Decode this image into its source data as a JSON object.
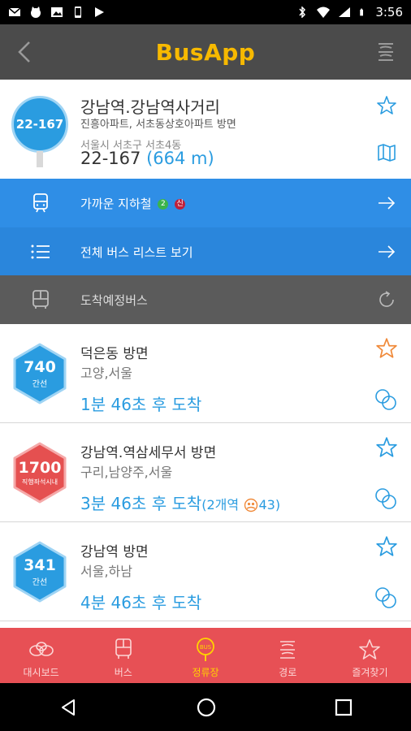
{
  "status_bar": {
    "time": "3:56",
    "icons": [
      "gmail-icon",
      "cat-icon",
      "image-icon",
      "phone-icon",
      "play-icon",
      "bluetooth-icon",
      "wifi-icon",
      "signal-icon",
      "battery-icon"
    ]
  },
  "app_bar": {
    "title": "BusApp",
    "back_icon": "chevron-left-icon",
    "menu_icon": "menu-icon",
    "title_color": "#f7b900"
  },
  "stop": {
    "sign_label": "22-167",
    "name": "강남역.강남역사거리",
    "direction": "진흥아파트, 서초동상호아파트 방면",
    "address": "서울시 서초구 서초4동",
    "id": "22-167",
    "distance": "(664 m)",
    "accent_color": "#2a9ce0"
  },
  "actions": [
    {
      "label": "가까운 지하철",
      "icon": "subway-icon",
      "badges": [
        {
          "text": "2",
          "color": "#3bb44b"
        },
        {
          "text": "신",
          "color": "#c0203a"
        }
      ]
    },
    {
      "label": "전체 버스 리스트 보기",
      "icon": "list-icon",
      "badges": []
    }
  ],
  "section": {
    "label": "도착예정버스",
    "icon": "bus-icon",
    "refresh_icon": "refresh-icon"
  },
  "buses": [
    {
      "number": "740",
      "type": "간선",
      "color": "#2a9ce0",
      "direction": "덕은동 방면",
      "region": "고양,서울",
      "arrival": "1분 46초 후 도착",
      "extra": "",
      "favorite": true
    },
    {
      "number": "1700",
      "type": "직행좌석시내",
      "color": "#e55050",
      "direction": "강남역.역삼세무서 방면",
      "region": "구리,남양주,서울",
      "arrival": "3분 46초 후 도착",
      "extra": "(2개역",
      "extra_count": "43)",
      "favorite": false
    },
    {
      "number": "341",
      "type": "간선",
      "color": "#2a9ce0",
      "direction": "강남역 방면",
      "region": "서울,하남",
      "arrival": "4분 46초 후 도착",
      "extra": "",
      "favorite": false
    }
  ],
  "tabs": [
    {
      "label": "대시보드",
      "icon": "dashboard-icon",
      "active": false
    },
    {
      "label": "버스",
      "icon": "bus-icon",
      "active": false
    },
    {
      "label": "정류장",
      "icon": "bus-stop-icon",
      "active": true
    },
    {
      "label": "경로",
      "icon": "route-icon",
      "active": false
    },
    {
      "label": "즐겨찾기",
      "icon": "star-icon",
      "active": false
    }
  ],
  "nav": [
    "back-icon",
    "home-icon",
    "recents-icon"
  ]
}
